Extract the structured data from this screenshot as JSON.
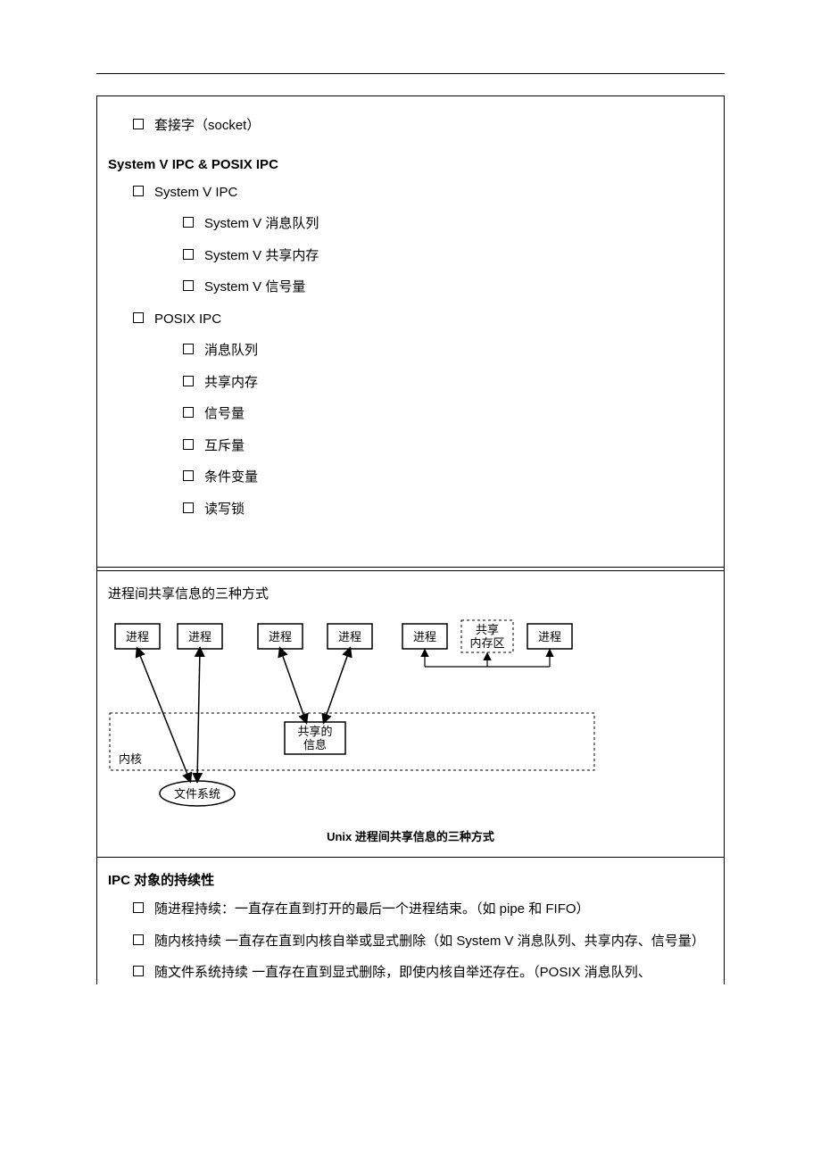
{
  "section1": {
    "socket_item": "套接字（socket）",
    "heading": "System V IPC & POSIX IPC",
    "sysv_label": "System V IPC",
    "sysv_items": [
      "System V  消息队列",
      "System V  共享内存",
      "System V  信号量"
    ],
    "posix_label": "POSIX IPC",
    "posix_items": [
      "消息队列",
      "共享内存",
      "信号量",
      "互斥量",
      "条件变量",
      "读写锁"
    ]
  },
  "diagram_cell": {
    "title": "进程间共享信息的三种方式",
    "boxes": {
      "proc": "进程",
      "shm_region_l1": "共享",
      "shm_region_l2": "内存区",
      "shared_info_l1": "共享的",
      "shared_info_l2": "信息",
      "kernel": "内核",
      "fs": "文件系统"
    },
    "caption": "Unix 进程间共享信息的三种方式"
  },
  "persistence_cell": {
    "title": "IPC 对象的持续性",
    "items": [
      "随进程持续：一直存在直到打开的最后一个进程结束。（如 pipe 和 FIFO）",
      "随内核持续 一直存在直到内核自举或显式删除（如 System V 消息队列、共享内存、信号量）",
      "随文件系统持续 一直存在直到显式删除，即使内核自举还存在。（POSIX 消息队列、"
    ]
  }
}
